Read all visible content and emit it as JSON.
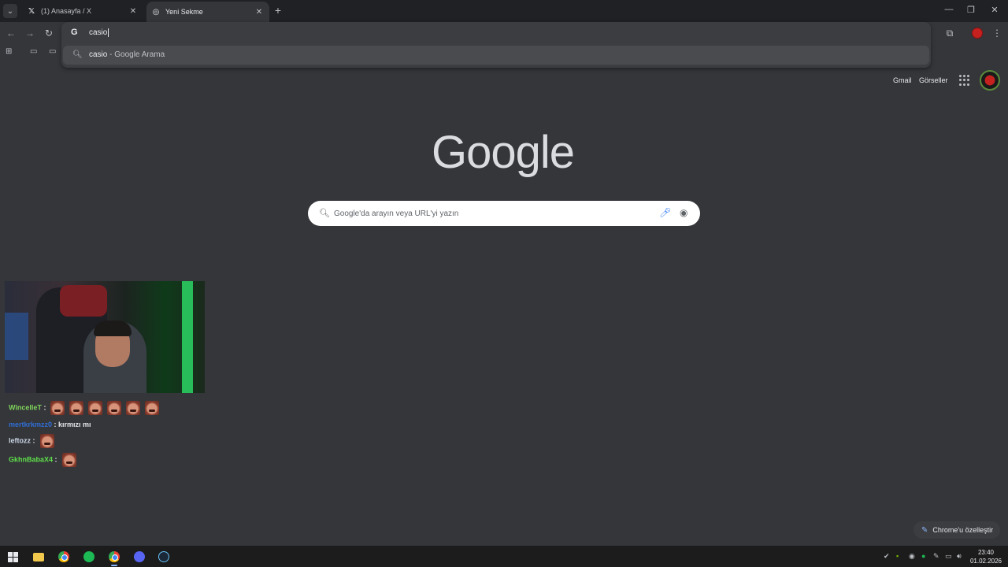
{
  "browser": {
    "tabs": [
      {
        "label": "(1) Anasayfa / X",
        "favicon": "X",
        "active": false
      },
      {
        "label": "Yeni Sekme",
        "favicon": "chrome-icon",
        "active": true
      }
    ],
    "omnibox": {
      "typed_text": "casio",
      "suggestion_query": "casio",
      "suggestion_suffix": " - Google Arama"
    }
  },
  "google": {
    "logo_text": "Google",
    "top_links": {
      "gmail": "Gmail",
      "images": "Görseller"
    },
    "search_placeholder": "Google'da arayın veya URL'yi yazın",
    "customize_label": "Chrome'u özelleştir"
  },
  "chat": [
    {
      "user": "WincelleT",
      "color": "#7fd35a",
      "text": "",
      "emotes": 6
    },
    {
      "user": "mertkrkmzz0",
      "color": "#2f6fd6",
      "text": "kırmızı mı",
      "emotes": 0
    },
    {
      "user": "leftozz",
      "color": "#c9d6e6",
      "text": "",
      "emotes": 1
    },
    {
      "user": "GkhnBabaX4",
      "color": "#5ee04a",
      "text": "",
      "emotes": 1
    }
  ],
  "taskbar": {
    "time": "23:40",
    "date": "01.02.2026"
  }
}
